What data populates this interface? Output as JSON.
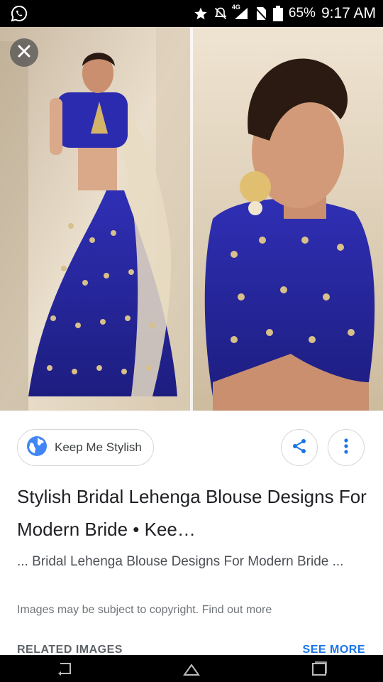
{
  "status_bar": {
    "network": "4G",
    "battery": "65%",
    "time": "9:17 AM"
  },
  "source": {
    "name": "Keep Me Stylish"
  },
  "result": {
    "title": "Stylish Bridal Lehenga Blouse Designs For Modern Bride • Kee…",
    "snippet": "... Bridal Lehenga Blouse Designs For Modern Bride ..."
  },
  "copyright_notice": "Images may be subject to copyright. Find out more",
  "related": {
    "heading": "RELATED IMAGES",
    "see_more": "SEE MORE"
  },
  "colors": {
    "accent": "#1a73e8",
    "lehenga_blue": "#2a2aa8"
  },
  "icons": [
    "whatsapp-call-icon",
    "star-icon",
    "mute-bell-icon",
    "signal-icon",
    "no-sim-icon",
    "battery-icon",
    "close-icon",
    "globe-icon",
    "share-icon",
    "more-vert-icon",
    "back-icon",
    "home-icon",
    "recents-icon"
  ]
}
